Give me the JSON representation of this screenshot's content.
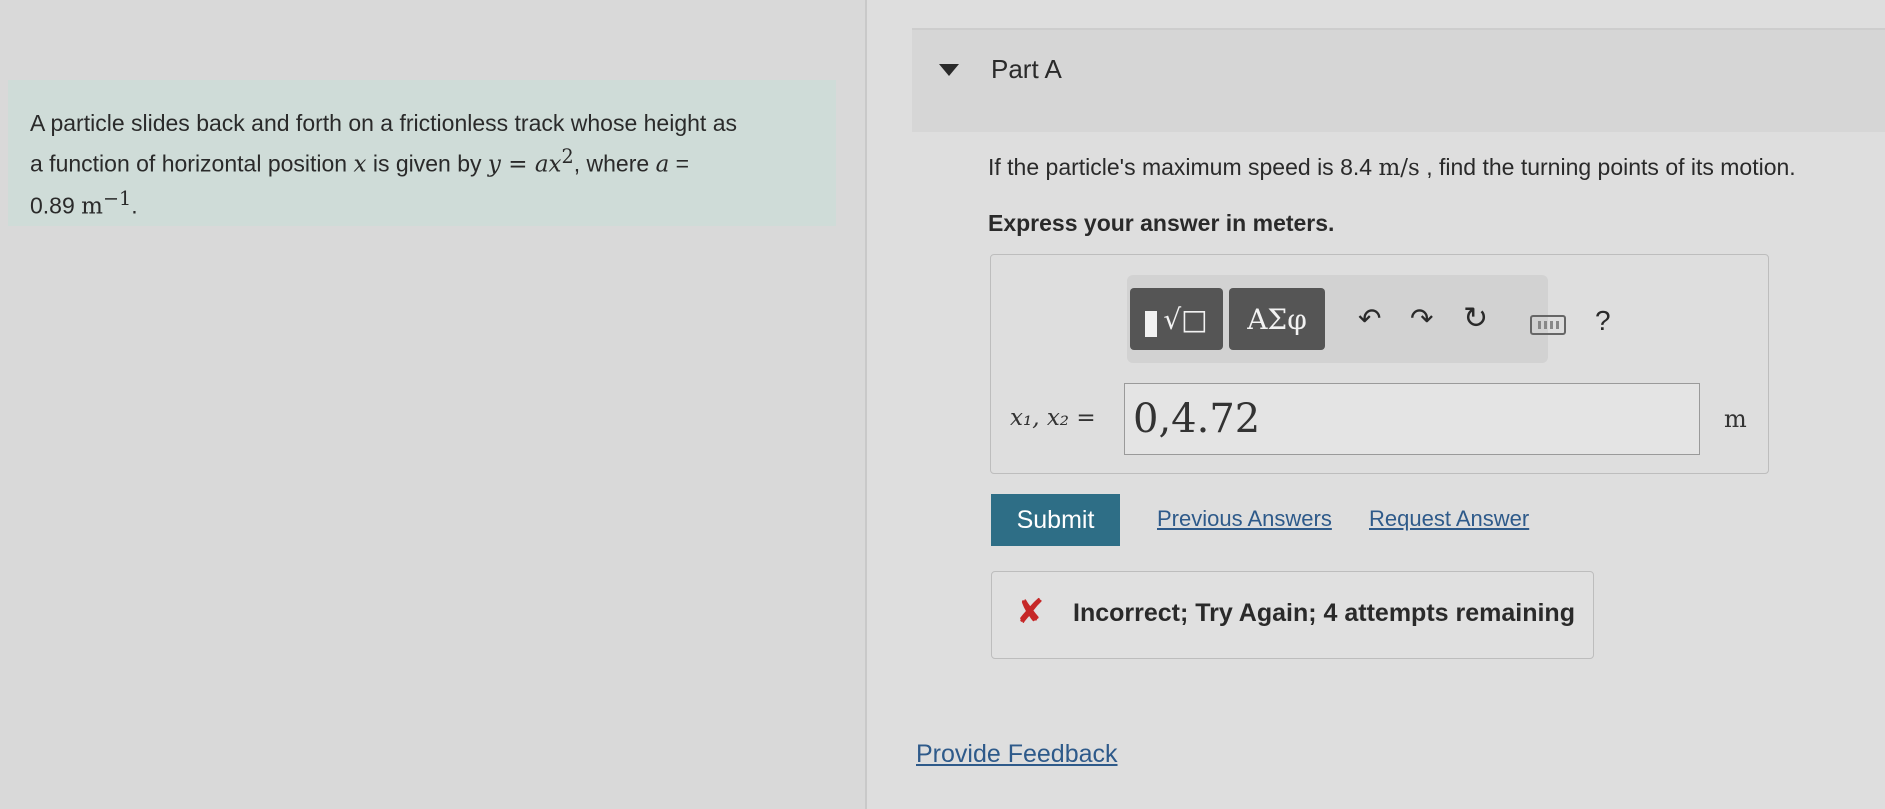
{
  "problem": {
    "text_1": "A particle slides back and forth on a frictionless track whose height as",
    "text_2a": "a function of horizontal position ",
    "text_2b": " is given by ",
    "text_2c": ", where ",
    "var_x": "x",
    "var_y": "y",
    "equals": " = ",
    "var_a": "a",
    "a_value": "0.89",
    "a_unit": "m",
    "a_unit_exp": "−1",
    "period": "."
  },
  "part": {
    "title": "Part A",
    "question_a": "If the particle's maximum speed is 8.4 ",
    "speed_unit": "m/s",
    "question_b": " , find the turning points of its motion.",
    "instruction": "Express your answer in meters."
  },
  "toolbar": {
    "templates_glyph": "√□",
    "greek_label": "ΑΣφ",
    "undo_glyph": "↶",
    "redo_glyph": "↷",
    "reset_glyph": "↻",
    "help_label": "?"
  },
  "answer": {
    "label": "x₁, x₂ =",
    "value": "0,4.72",
    "unit": "m"
  },
  "actions": {
    "submit_label": "Submit",
    "previous_answers": "Previous Answers",
    "request_answer": "Request Answer"
  },
  "feedback": {
    "icon": "✘",
    "message": "Incorrect; Try Again; 4 attempts remaining",
    "status_color": "#c62828"
  },
  "footer": {
    "provide_feedback": "Provide Feedback"
  },
  "colors": {
    "accent": "#2e6e86",
    "link": "#2e5a8a"
  }
}
